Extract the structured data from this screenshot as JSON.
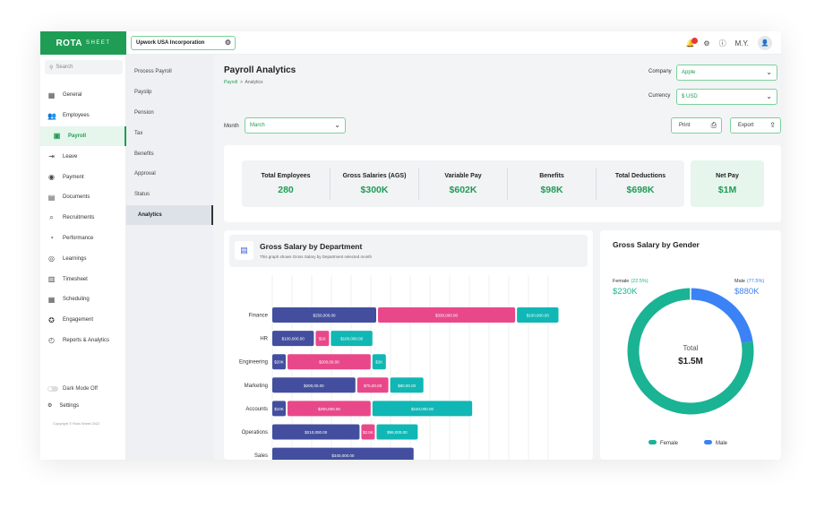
{
  "app": {
    "logo_main": "ROTA",
    "logo_sub": "SHEET",
    "company_chip": "Upwork USA Incorporation",
    "user_initials": "M.Y."
  },
  "colors": {
    "brand": "#1f9d55",
    "dept_series": [
      "#434f9e",
      "#e8488a",
      "#10b7b5"
    ],
    "female": "#1ab394",
    "male": "#3b82f6"
  },
  "search": {
    "placeholder": "Search"
  },
  "sidebar": {
    "items": [
      {
        "label": "General",
        "icon": "grid-icon"
      },
      {
        "label": "Employees",
        "icon": "people-icon"
      },
      {
        "label": "Payroll",
        "icon": "wallet-icon",
        "active": true
      },
      {
        "label": "Leave",
        "icon": "logout-icon"
      },
      {
        "label": "Payment",
        "icon": "payment-icon"
      },
      {
        "label": "Documents",
        "icon": "document-icon"
      },
      {
        "label": "Recruitments",
        "icon": "search-person-icon"
      },
      {
        "label": "Performance",
        "icon": "gauge-icon"
      },
      {
        "label": "Learnings",
        "icon": "target-icon"
      },
      {
        "label": "Timesheet",
        "icon": "timesheet-icon"
      },
      {
        "label": "Scheduling",
        "icon": "calendar-icon"
      },
      {
        "label": "Engagement",
        "icon": "award-icon"
      },
      {
        "label": "Reports & Analytics",
        "icon": "chart-icon"
      }
    ],
    "dark_mode": "Dark Mode Off",
    "settings": "Settings",
    "copyright": "Copyright © Rota Sheet 2022"
  },
  "subnav": {
    "items": [
      "Process Payroll",
      "Payslip",
      "Pension",
      "Tax",
      "Benefits",
      "Approval",
      "Status",
      "Analytics"
    ],
    "active_index": 7
  },
  "header": {
    "title": "Payroll Analytics",
    "breadcrumb": [
      "Payroll",
      ">",
      "Analytics"
    ],
    "company_label": "Company",
    "company_value": "Apple",
    "currency_label": "Currency",
    "currency_value": "$  USD",
    "month_label": "Month",
    "month_value": "March",
    "print_label": "Print",
    "export_label": "Export"
  },
  "stats": [
    {
      "label": "Total Employees",
      "value": "280"
    },
    {
      "label": "Gross Salaries (AGS)",
      "value": "$300K"
    },
    {
      "label": "Variable Pay",
      "value": "$602K"
    },
    {
      "label": "Benefits",
      "value": "$98K"
    },
    {
      "label": "Total Deductions",
      "value": "$698K"
    }
  ],
  "net_pay": {
    "label": "Net Pay",
    "value": "$1M"
  },
  "dept_chart": {
    "title": "Gross Salary by Department",
    "subtitle": "This graph shows Gross Salary by Department selected month"
  },
  "chart_data": [
    {
      "type": "bar",
      "orientation": "horizontal",
      "stacked": true,
      "title": "Gross Salary by Department",
      "categories": [
        "Finance",
        "HR",
        "Engineering",
        "Marketing",
        "Accounts",
        "Operations",
        "Sales"
      ],
      "series": [
        {
          "values": [
            250000,
            100000,
            20000,
            200000,
            10000,
            210000,
            340000
          ],
          "labels": [
            "$250,000.00",
            "$100,000.00",
            "$20K",
            "$200,00.00",
            "$10K",
            "$210,000.00",
            "$340,000.00"
          ]
        },
        {
          "values": [
            330000,
            10000,
            200000,
            75000,
            200000,
            5000,
            0
          ],
          "labels": [
            "$330,000.00",
            "$1K",
            "$200,00.00",
            "$75,00.00",
            "$200,000.00",
            "$2.5K",
            ""
          ]
        },
        {
          "values": [
            100000,
            100000,
            20000,
            80000,
            240000,
            99000,
            0
          ],
          "labels": [
            "$100,000.00",
            "$100,000.00",
            "$2K",
            "$80,00.00",
            "$240,000.00",
            "$99,000.00",
            ""
          ]
        }
      ],
      "grid": true
    },
    {
      "type": "pie",
      "variant": "donut",
      "title": "Gross Salary by Gender",
      "slices": [
        {
          "name": "Female",
          "percent_label": "(22.5%)",
          "value_label": "$230K",
          "share": 0.225
        },
        {
          "name": "Male",
          "percent_label": "(77.5%)",
          "value_label": "$880K",
          "share": 0.775
        }
      ],
      "center_label": "Total",
      "center_value": "$1.5M",
      "legend": [
        "Female",
        "Male"
      ],
      "legend_position": "bottom"
    }
  ]
}
